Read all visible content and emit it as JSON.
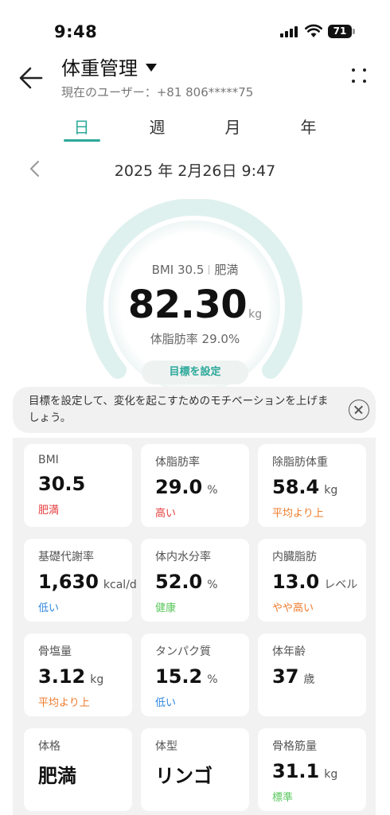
{
  "status_bar": {
    "time": "9:48",
    "battery": "71"
  },
  "header": {
    "title": "体重管理",
    "user_line": "現在のユーザー：+81 806*****75"
  },
  "tabs": [
    {
      "label": "日",
      "active": true
    },
    {
      "label": "週",
      "active": false
    },
    {
      "label": "月",
      "active": false
    },
    {
      "label": "年",
      "active": false
    }
  ],
  "date": "2025 年 2月26日 9:47",
  "summary": {
    "bmi_label": "BMI 30.5",
    "bmi_category": "肥満",
    "weight": "82.30",
    "weight_unit": "kg",
    "body_fat": "体脂肪率 29.0%",
    "goal_button": "目標を設定"
  },
  "tip": {
    "text": "目標を設定して、変化を起こすためのモチベーションを上げましょう。"
  },
  "colors": {
    "accent": "#2da89a",
    "gauge_track": "#dff1ee",
    "red": "#e63c3c",
    "orange": "#ef7a2a",
    "blue": "#2e86de",
    "green": "#59c75d"
  },
  "metrics": [
    {
      "label": "BMI",
      "value": "30.5",
      "unit": "",
      "status": "肥満",
      "status_color": "red"
    },
    {
      "label": "体脂肪率",
      "value": "29.0",
      "unit": "%",
      "status": "高い",
      "status_color": "red"
    },
    {
      "label": "除脂肪体重",
      "value": "58.4",
      "unit": "kg",
      "status": "平均より上",
      "status_color": "orange"
    },
    {
      "label": "基礎代謝率",
      "value": "1,630",
      "unit": "kcal/d",
      "status": "低い",
      "status_color": "blue"
    },
    {
      "label": "体内水分率",
      "value": "52.0",
      "unit": "%",
      "status": "健康",
      "status_color": "green"
    },
    {
      "label": "内臓脂肪",
      "value": "13.0",
      "unit": "レベル",
      "status": "やや高い",
      "status_color": "orange"
    },
    {
      "label": "骨塩量",
      "value": "3.12",
      "unit": "kg",
      "status": "平均より上",
      "status_color": "orange"
    },
    {
      "label": "タンパク質",
      "value": "15.2",
      "unit": "%",
      "status": "低い",
      "status_color": "blue"
    },
    {
      "label": "体年齢",
      "value": "37",
      "unit": "歳",
      "status": "",
      "status_color": ""
    },
    {
      "label": "体格",
      "value": "肥満",
      "unit": "",
      "status": "",
      "status_color": ""
    },
    {
      "label": "体型",
      "value": "リンゴ",
      "unit": "",
      "status": "",
      "status_color": ""
    },
    {
      "label": "骨格筋量",
      "value": "31.1",
      "unit": "kg",
      "status": "標準",
      "status_color": "green"
    }
  ]
}
